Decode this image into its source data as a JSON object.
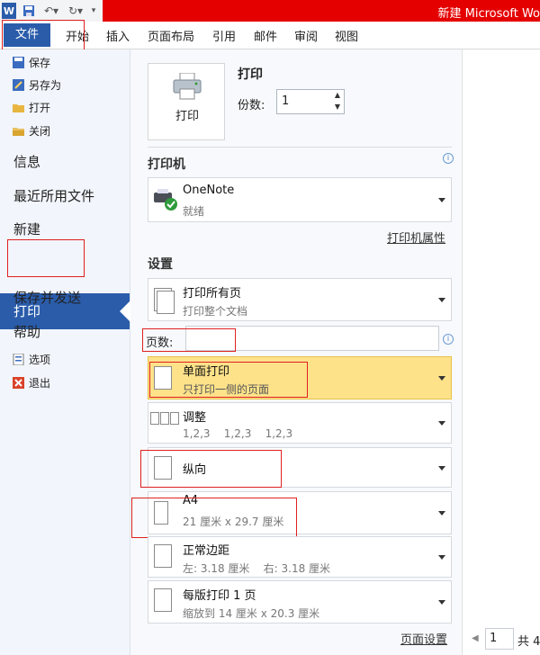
{
  "window": {
    "title": "新建 Microsoft Wo"
  },
  "ribbon": {
    "tabs": [
      "文件",
      "开始",
      "插入",
      "页面布局",
      "引用",
      "邮件",
      "审阅",
      "视图"
    ]
  },
  "backstage": {
    "small_items": [
      "保存",
      "另存为",
      "打开",
      "关闭"
    ],
    "big_items": [
      "信息",
      "最近所用文件",
      "新建",
      "打印",
      "保存并发送",
      "帮助"
    ],
    "bottom_items": [
      "选项",
      "退出"
    ]
  },
  "print": {
    "button_label": "打印",
    "section_title": "打印",
    "copies_label": "份数:",
    "copies_value": "1"
  },
  "printer": {
    "section_title": "打印机",
    "name": "OneNote",
    "status": "就绪",
    "properties_link": "打印机属性"
  },
  "settings": {
    "section_title": "设置",
    "pages_label": "页数:",
    "pages_value": "",
    "options": [
      {
        "title": "打印所有页",
        "subtitle": "打印整个文档"
      },
      {
        "title": "单面打印",
        "subtitle": "只打印一侧的页面"
      },
      {
        "title": "调整",
        "subtitle": "1,2,3    1,2,3    1,2,3"
      },
      {
        "title": "纵向",
        "subtitle": ""
      },
      {
        "title": "A4",
        "subtitle": "21 厘米 x 29.7 厘米"
      },
      {
        "title": "正常边距",
        "subtitle": "左: 3.18 厘米    右: 3.18 厘米"
      },
      {
        "title": "每版打印 1 页",
        "subtitle": "缩放到 14 厘米 x 20.3 厘米"
      }
    ],
    "page_setup_link": "页面设置"
  },
  "preview_nav": {
    "current_page": "1",
    "total_label": "共 4"
  },
  "colors": {
    "accent": "#2a5caa",
    "titlebar_red": "#e50000",
    "highlight": "#fde28a",
    "annotation": "#e02020"
  }
}
